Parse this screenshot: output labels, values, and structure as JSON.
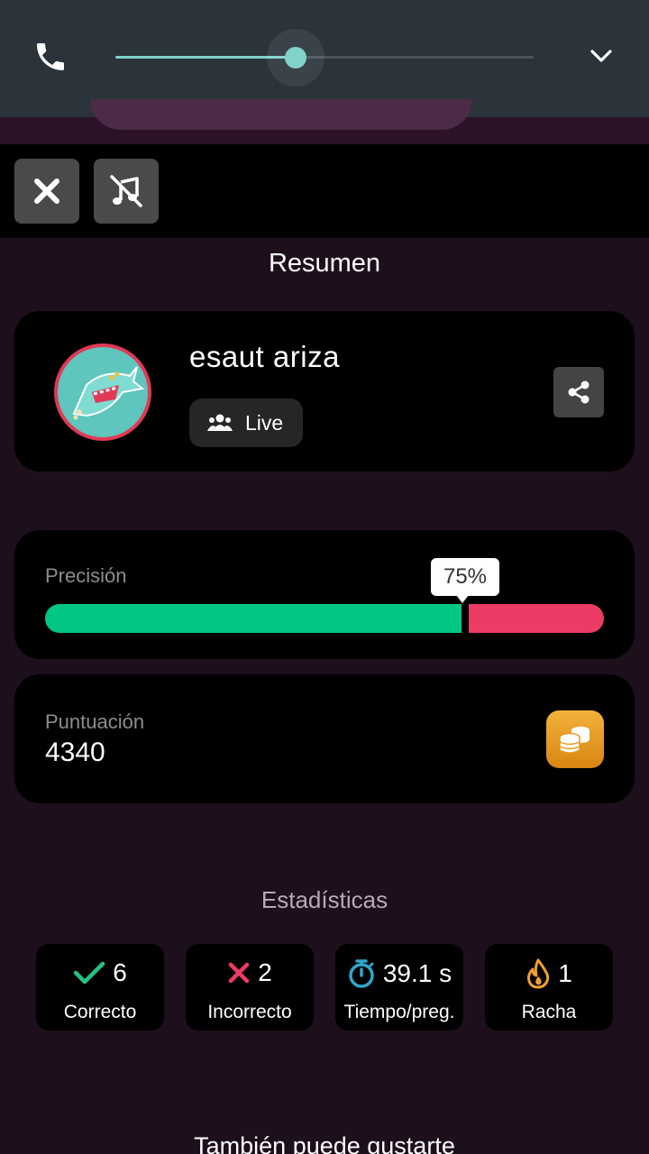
{
  "call_bar": {
    "slider_value": 0.43,
    "accent_color": "#7fd3c9"
  },
  "toolbar": {
    "close_icon": "close-icon",
    "music_off_icon": "music-off-icon"
  },
  "summary": {
    "title": "Resumen",
    "player": {
      "name": "esaut ariza",
      "mode_label": "Live"
    },
    "accuracy": {
      "label": "Precisión",
      "percent_label": "75%",
      "value": 0.75,
      "correct_color": "#00c785",
      "incorrect_color": "#ec3b64"
    },
    "score": {
      "label": "Puntuación",
      "value": "4340"
    }
  },
  "stats": {
    "title": "Estadísticas",
    "items": [
      {
        "value": "6",
        "label": "Correcto",
        "icon": "check-icon",
        "color": "#26c281"
      },
      {
        "value": "2",
        "label": "Incorrecto",
        "icon": "x-icon",
        "color": "#ec3b64"
      },
      {
        "value": "39.1 s",
        "label": "Tiempo/preg.",
        "icon": "stopwatch-icon",
        "color": "#2fa6c9"
      },
      {
        "value": "1",
        "label": "Racha",
        "icon": "flame-icon",
        "color": "#f0a030"
      }
    ]
  },
  "more": {
    "title": "También puede gustarte"
  }
}
